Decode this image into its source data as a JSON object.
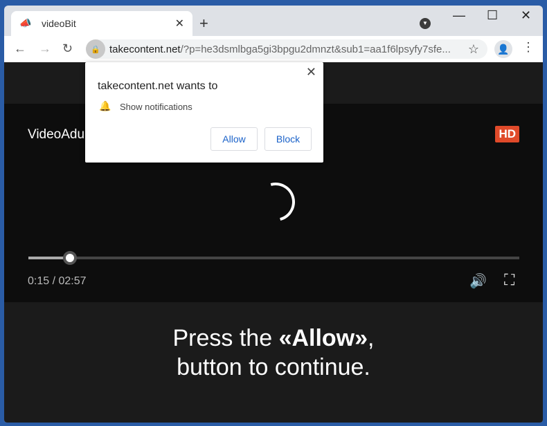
{
  "tab": {
    "title": "videoBit",
    "favicon": "megaphone-icon"
  },
  "toolbar": {
    "url_domain": "takecontent.net",
    "url_rest": "/?p=he3dsmlbga5gi3bpgu2dmnzt&sub1=aa1f6lpsyfy7sfe..."
  },
  "popup": {
    "heading": "takecontent.net wants to",
    "permission": "Show notifications",
    "allow": "Allow",
    "block": "Block"
  },
  "video": {
    "title": "VideoAdu",
    "badge": "HD",
    "current_time": "0:15",
    "duration": "02:57",
    "progress_percent": 8.5
  },
  "message": {
    "line1_pre": "Press the ",
    "line1_bold": "«Allow»",
    "line1_post": ",",
    "line2": "button to continue."
  },
  "colors": {
    "hd_badge": "#e04a2a",
    "button_text": "#1a62c9",
    "frame": "#2a5ca6"
  }
}
